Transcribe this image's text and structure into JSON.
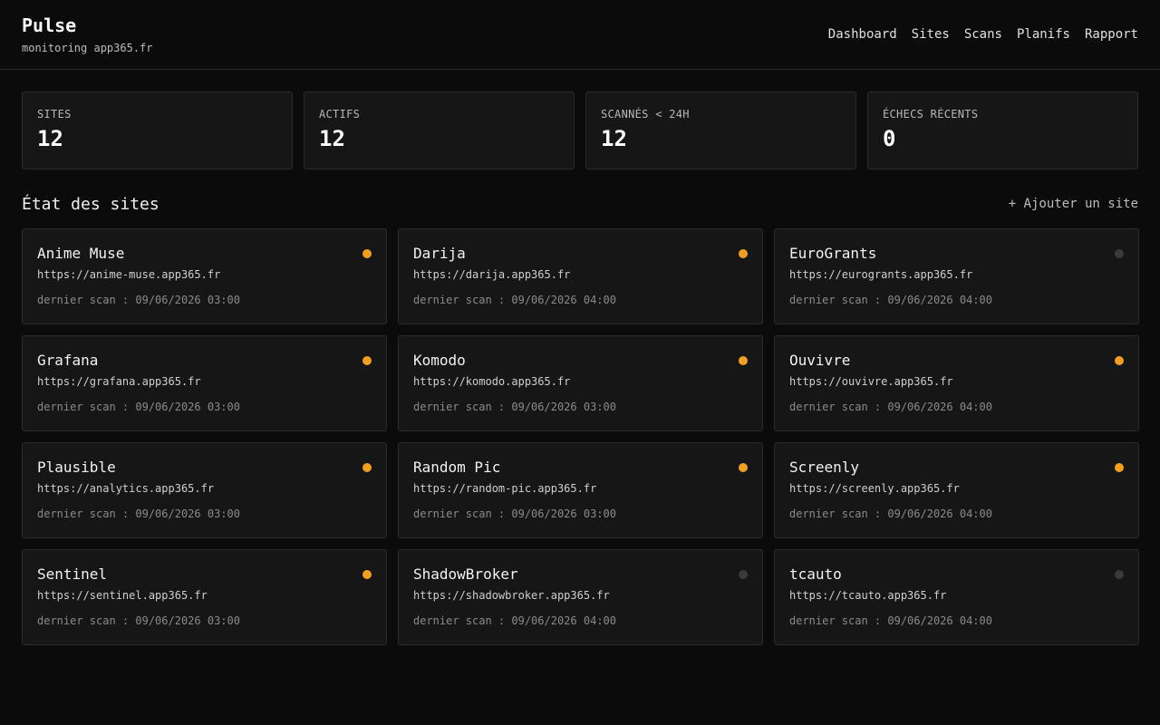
{
  "brand": {
    "title": "Pulse",
    "subtitle": "monitoring app365.fr"
  },
  "nav": [
    "Dashboard",
    "Sites",
    "Scans",
    "Planifs",
    "Rapport"
  ],
  "stats": [
    {
      "label": "SITES",
      "value": "12"
    },
    {
      "label": "ACTIFS",
      "value": "12"
    },
    {
      "label": "SCANNÉS < 24H",
      "value": "12"
    },
    {
      "label": "ÉCHECS RÉCENTS",
      "value": "0"
    }
  ],
  "section": {
    "title": "État des sites",
    "add_label": "+ Ajouter un site"
  },
  "colors": {
    "status_ok": "#f0a01e",
    "status_off": "#3a3a3a"
  },
  "sites": [
    {
      "name": "Anime Muse",
      "url": "https://anime-muse.app365.fr",
      "scan": "dernier scan : 09/06/2026 03:00",
      "status": "ok"
    },
    {
      "name": "Darija",
      "url": "https://darija.app365.fr",
      "scan": "dernier scan : 09/06/2026 04:00",
      "status": "ok"
    },
    {
      "name": "EuroGrants",
      "url": "https://eurogrants.app365.fr",
      "scan": "dernier scan : 09/06/2026 04:00",
      "status": "off"
    },
    {
      "name": "Grafana",
      "url": "https://grafana.app365.fr",
      "scan": "dernier scan : 09/06/2026 03:00",
      "status": "ok"
    },
    {
      "name": "Komodo",
      "url": "https://komodo.app365.fr",
      "scan": "dernier scan : 09/06/2026 03:00",
      "status": "ok"
    },
    {
      "name": "Ouvivre",
      "url": "https://ouvivre.app365.fr",
      "scan": "dernier scan : 09/06/2026 04:00",
      "status": "ok"
    },
    {
      "name": "Plausible",
      "url": "https://analytics.app365.fr",
      "scan": "dernier scan : 09/06/2026 03:00",
      "status": "ok"
    },
    {
      "name": "Random Pic",
      "url": "https://random-pic.app365.fr",
      "scan": "dernier scan : 09/06/2026 03:00",
      "status": "ok"
    },
    {
      "name": "Screenly",
      "url": "https://screenly.app365.fr",
      "scan": "dernier scan : 09/06/2026 04:00",
      "status": "ok"
    },
    {
      "name": "Sentinel",
      "url": "https://sentinel.app365.fr",
      "scan": "dernier scan : 09/06/2026 03:00",
      "status": "ok"
    },
    {
      "name": "ShadowBroker",
      "url": "https://shadowbroker.app365.fr",
      "scan": "dernier scan : 09/06/2026 04:00",
      "status": "off"
    },
    {
      "name": "tcauto",
      "url": "https://tcauto.app365.fr",
      "scan": "dernier scan : 09/06/2026 04:00",
      "status": "off"
    }
  ]
}
